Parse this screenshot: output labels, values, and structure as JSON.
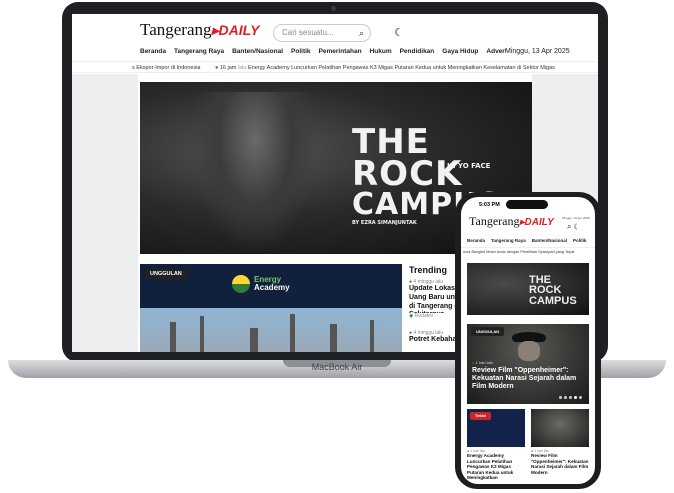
{
  "laptop_label": "MacBook Air",
  "site": {
    "logo_main": "Tangerang",
    "logo_accent": "DAILY",
    "search_placeholder": "Cari sesuatu...",
    "nav": [
      "Beranda",
      "Tangerang Raya",
      "Banten/Nasional",
      "Politik",
      "Pemerintahan",
      "Hukum",
      "Pendidikan",
      "Gaya Hidup",
      "Advertorial"
    ],
    "date": "Minggu, 13 Apr 2025",
    "ticker": {
      "item1": "s Ekspor-Impor di Indonesia",
      "time": "16 jam",
      "ago": "lalu",
      "item2": "Energy Academy Luncurkan Pelatihan Pengawas K3 Migas Putaran Kedua untuk Meningkatkan Keselamatan di Sektor Migas"
    },
    "hero": {
      "line1": "THE",
      "line2": "ROCK",
      "line3": "CAMPUS",
      "in_yo_face": "IN YO FACE",
      "byline": "BY EZRA SIMANJUNTAK"
    },
    "featured": {
      "badge": "UNGGULAN",
      "brand_line1": "Energy",
      "brand_line2": "Academy"
    },
    "trending": {
      "title": "Trending",
      "items": [
        {
          "meta": "4 minggu lalu",
          "headline": "Update Lokasi Pencairan Uang Baru untuk Lebaran di Tangerang dan Sekitarnya",
          "author": "Redaksi"
        },
        {
          "meta": "4 minggu lalu",
          "headline": "Potret Kebahagiaan"
        }
      ]
    }
  },
  "phone": {
    "time": "5:03 PM",
    "date": "Minggu, 13 Apr 2025",
    "nav": [
      "Beranda",
      "Tangerang Raya",
      "Banten/Nasional",
      "Politik"
    ],
    "ticker": "mua Bengkel Motor Anda dengan Pemilihan Sparepart yang Tepat",
    "hero_line1": "THE",
    "hero_line2": "ROCK",
    "hero_line3": "CAMPUS",
    "card": {
      "badge": "UNGGULAN",
      "meta": "1 hari lalu",
      "title": "Review Film \"Oppenheimer\": Kekuatan Narasi Sejarah dalam Film Modern"
    },
    "mini": [
      {
        "badge": "Terkini",
        "meta": "1 hari lalu",
        "title": "Energy Academy Luncurkan Pelatihan Pengawas K3 Migas Putaran Kedua untuk Meningkatkan"
      },
      {
        "meta": "1 hari lalu",
        "title": "Review Film \"Oppenheimer\": Kekuatan Narasi Sejarah dalam Film Modern"
      }
    ]
  }
}
